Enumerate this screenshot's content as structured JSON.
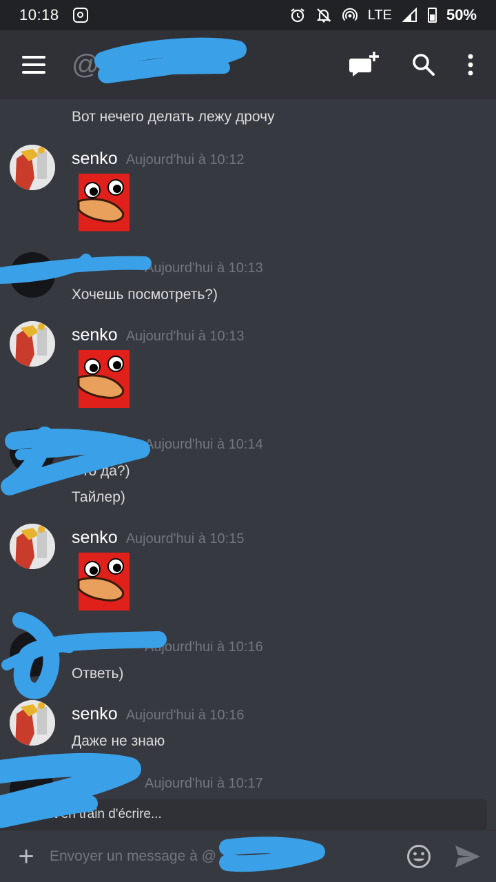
{
  "status_bar": {
    "time": "10:18",
    "network": "LTE",
    "battery": "50%"
  },
  "header": {
    "at_symbol": "@",
    "icons": [
      "menu-icon",
      "new-dm-icon",
      "search-icon",
      "more-icon"
    ]
  },
  "messages": [
    {
      "author": "",
      "time": "",
      "lines": [
        "Вот нечего делать лежу дрочу"
      ]
    },
    {
      "author": "senko",
      "time": "Aujourd'hui à 10:12",
      "sticker": "knuckles"
    },
    {
      "author": "",
      "time": "Aujourd'hui à 10:13",
      "lines": [
        "Хочешь посмотреть?)"
      ]
    },
    {
      "author": "senko",
      "time": "Aujourd'hui à 10:13",
      "sticker": "knuckles"
    },
    {
      "author": "",
      "time": "Aujourd'hui à 10:14",
      "lines": [
        "Это да?)",
        "Тайлер)"
      ]
    },
    {
      "author": "senko",
      "time": "Aujourd'hui à 10:15",
      "sticker": "knuckles"
    },
    {
      "author": "",
      "time": "Aujourd'hui à 10:16",
      "lines": [
        "Ответь)"
      ]
    },
    {
      "author": "senko",
      "time": "Aujourd'hui à 10:16",
      "lines": [
        "Даже не знаю"
      ]
    },
    {
      "author": "",
      "time": "Aujourd'hui à 10:17"
    }
  ],
  "typing_indicator": "est en train d'écrire...",
  "composer": {
    "placeholder": "Envoyer un message à @"
  },
  "colors": {
    "background": "#36393f",
    "header": "#2f3136",
    "status_bar": "#202225",
    "timestamp": "#72767d",
    "redaction": "#3aa0e8"
  }
}
